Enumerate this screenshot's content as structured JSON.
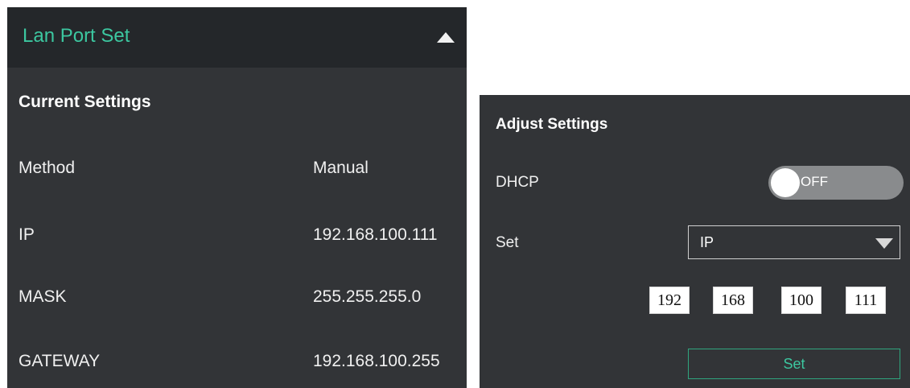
{
  "lan_panel": {
    "title": "Lan Port Set",
    "current": {
      "heading": "Current Settings",
      "rows": [
        {
          "label": "Method",
          "value": "Manual"
        },
        {
          "label": "IP",
          "value": "192.168.100.111"
        },
        {
          "label": "MASK",
          "value": "255.255.255.0"
        },
        {
          "label": "GATEWAY",
          "value": "192.168.100.255"
        }
      ]
    }
  },
  "adjust": {
    "heading": "Adjust Settings",
    "dhcp_label": "DHCP",
    "dhcp_state": "OFF",
    "set_label": "Set",
    "set_option": "IP",
    "octets": [
      "192",
      "168",
      "100",
      "111"
    ],
    "set_button": "Set"
  },
  "colors": {
    "accent": "#3cc7a0",
    "panel_bg": "#323437",
    "header_bg": "#24272a"
  }
}
